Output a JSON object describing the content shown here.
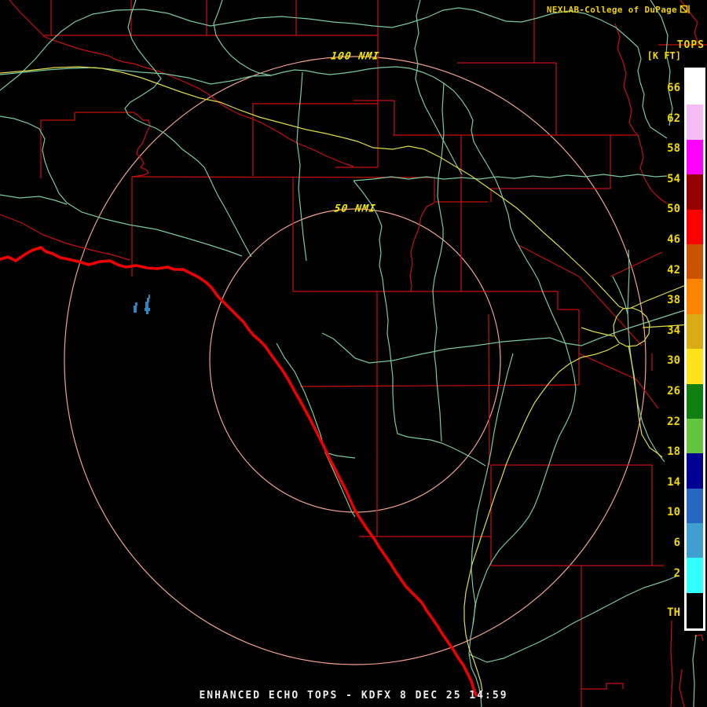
{
  "branding": {
    "text": "NEXLAB-College of DuPage",
    "icon": "cod-logo-icon",
    "color": "#F0D000"
  },
  "scale": {
    "title": "TOPS",
    "units": "[K FT]",
    "th_label": "TH",
    "tick_labels": [
      "66",
      "62",
      "58",
      "54",
      "50",
      "46",
      "42",
      "38",
      "34",
      "30",
      "26",
      "22",
      "18",
      "14",
      "10",
      "6",
      "2"
    ],
    "band_colors": [
      "#FFFFFF",
      "#F6BCF6",
      "#FF00FF",
      "#960000",
      "#FF0000",
      "#CB5300",
      "#FF8400",
      "#D9AC15",
      "#FFE41C",
      "#0F7F13",
      "#64C53C",
      "#000093",
      "#2667C2",
      "#3F9FD0",
      "#33FFFF"
    ],
    "label_color": "#F0D800"
  },
  "rings": {
    "r100_label": "100 NMI",
    "r50_label": "50 NMI",
    "label_color": "#F0E800"
  },
  "title_bar": {
    "text": "ENHANCED ECHO TOPS - KDFX 8 DEC 25 14:59",
    "color": "#EDEDED"
  },
  "map": {
    "background": "#000000",
    "county_color": "#C81010",
    "river_color": "#7BC89E",
    "road_color": "#DBDB47",
    "border_color": "#EE0000",
    "ring_color": "#F0A28E",
    "echo_color": "#2E86C1"
  }
}
